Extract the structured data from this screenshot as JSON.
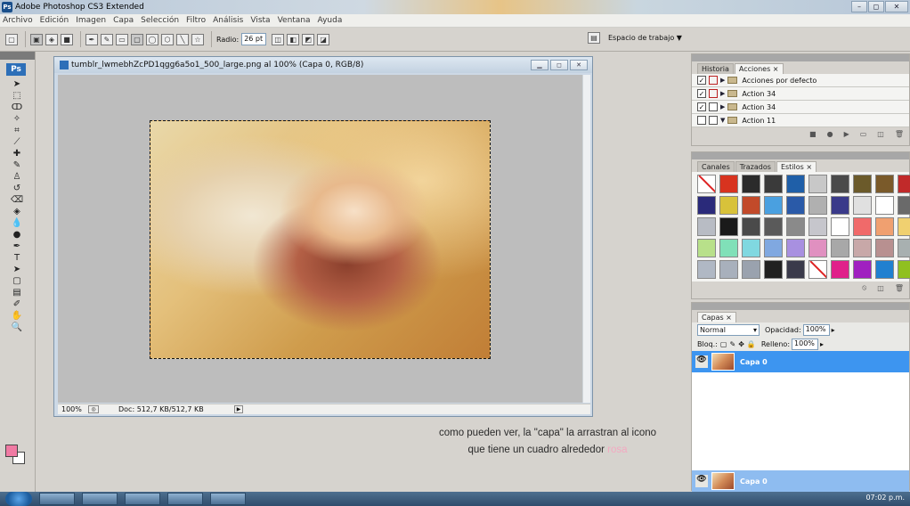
{
  "window": {
    "title": "Adobe Photoshop CS3 Extended",
    "controls": [
      "–",
      "◻",
      "✕"
    ]
  },
  "menu": [
    "Archivo",
    "Edición",
    "Imagen",
    "Capa",
    "Selección",
    "Filtro",
    "Análisis",
    "Vista",
    "Ventana",
    "Ayuda"
  ],
  "options_bar": {
    "radius_label": "Radio:",
    "radius_value": "26 pt",
    "workspace_label": "Espacio de trabajo ▼"
  },
  "document": {
    "title": "tumblr_lwmebhZcPD1qgg6a5o1_500_large.png al 100% (Capa 0, RGB/8)",
    "zoom": "100%",
    "doc_size": "Doc: 512,7 KB/512,7 KB"
  },
  "caption": {
    "line1": "como pueden ver, la \"capa\" la arrastran al icono",
    "line2": "que tiene un cuadro alrededor",
    "line2_highlight": "rosa"
  },
  "actions_panel": {
    "tabs": [
      "Historia",
      "Acciones ×"
    ],
    "items": [
      "Acciones por defecto",
      "Action 34",
      "Action 34",
      "Action 11"
    ]
  },
  "styles_panel": {
    "tabs": [
      "Canales",
      "Trazados",
      "Estilos ×"
    ],
    "swatches": [
      "#ffffff",
      "#d8331f",
      "#2b2b2b",
      "#3a3a3a",
      "#1f5fa8",
      "#c8c8c8",
      "#4a4a4a",
      "#6b5a2a",
      "#7a5a2a",
      "#c12a2a",
      "#2a2a7a",
      "#d8c23a",
      "#c24a2a",
      "#4aa0e0",
      "#2a5aa8",
      "#b0b0b0",
      "#3a3a8a",
      "#e0e0e0",
      "#ffffff",
      "#6a6a6a",
      "#b8bcc4",
      "#1a1a1a",
      "#4a4a4a",
      "#5a5a5a",
      "#8a8a8a",
      "#c6c6cc",
      "#ffffff",
      "#f06a6a",
      "#f0a070",
      "#f0d070",
      "#b8e08a",
      "#80e0b8",
      "#80d8e0",
      "#80a8e0",
      "#a890e0",
      "#e090c0",
      "#a8a8a8",
      "#c8a8a8",
      "#b89090",
      "#a8b0b0",
      "#b0b8c4",
      "#a8b0bc",
      "#9aa2ae",
      "#202020",
      "#3a3a4a",
      "#ffffff",
      "#e0208a",
      "#a020c0",
      "#2080d0",
      "#90c020"
    ]
  },
  "layers_panel": {
    "tabs": [
      "Capas ×"
    ],
    "blend_mode": "Normal",
    "opacity_label": "Opacidad:",
    "opacity_value": "100%",
    "lock_label": "Bloq.:",
    "fill_label": "Relleno:",
    "fill_value": "100%",
    "layer_name": "Capa 0",
    "drag_layer_name": "Capa 0"
  },
  "taskbar": {
    "clock": "07:02 p.m."
  }
}
